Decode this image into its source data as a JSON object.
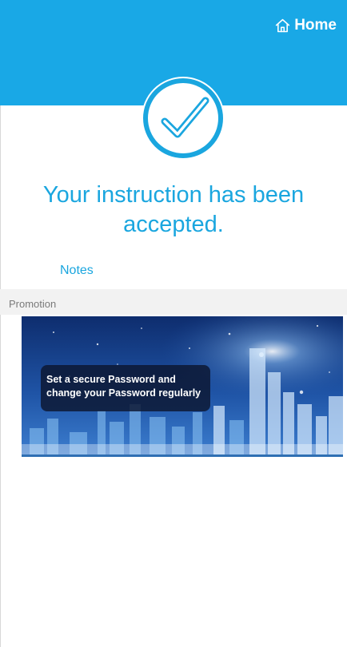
{
  "header": {
    "home_label": "Home",
    "home_icon": "home-icon",
    "color": "#19a8e6"
  },
  "status": {
    "icon": "check-circle-icon",
    "message": "Your instruction has been accepted."
  },
  "notes": {
    "label": "Notes"
  },
  "promotion": {
    "section_label": "Promotion",
    "banner_line1": "Set a secure Password and",
    "banner_line2": "change your Password regularly"
  },
  "colors": {
    "accent": "#1aa6df",
    "section_bg": "#f2f2f2"
  }
}
